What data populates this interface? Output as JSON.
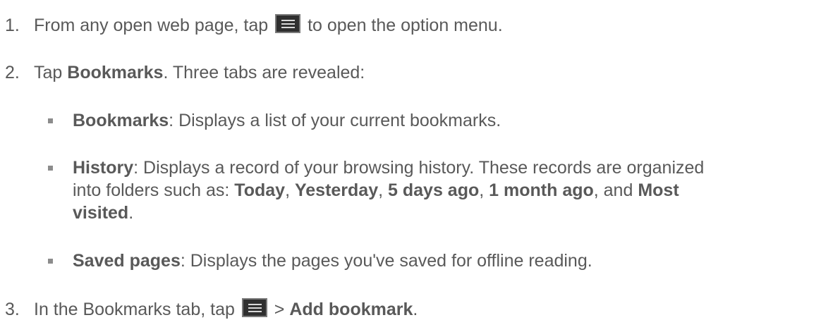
{
  "steps": [
    {
      "number": "1.",
      "before": "From any open web page, tap",
      "icon": "menu-icon",
      "after": "to open the option menu."
    },
    {
      "number": "2.",
      "prefix": "Tap",
      "bold": "Bookmarks",
      "suffix": ". Three tabs are revealed:"
    },
    {
      "number": "3.",
      "before": "In the Bookmarks tab, tap",
      "icon": "menu-icon",
      "separator": ">",
      "bold": "Add bookmark",
      "suffix": "."
    }
  ],
  "tabs": [
    {
      "name": "Bookmarks",
      "description": ": Displays a list of your current bookmarks."
    },
    {
      "name": "History",
      "description_line1": ": Displays a record of your browsing history. These records are organized",
      "description_line2_prefix": "into folders such as:",
      "folders": [
        "Today",
        "Yesterday",
        "5 days ago",
        "1 month ago",
        "Most",
        "visited"
      ],
      "comma": ",",
      "and": ", and",
      "period": "."
    },
    {
      "name": "Saved pages",
      "description": ": Displays the pages you've saved for offline reading."
    }
  ],
  "colors": {
    "text": "#595959",
    "icon_background": "#2f2f2f",
    "bullet": "#8c8c8c"
  }
}
